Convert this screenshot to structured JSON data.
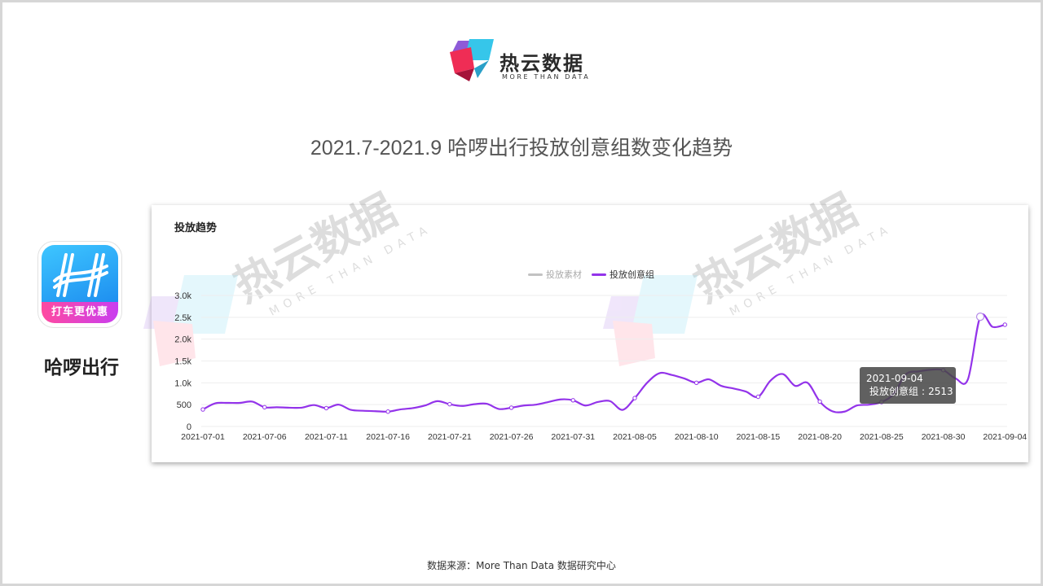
{
  "brand": {
    "name": "热云数据",
    "tagline": "MORE THAN DATA"
  },
  "page_title": "2021.7-2021.9 哈啰出行投放创意组数变化趋势",
  "app": {
    "name": "哈啰出行",
    "slogan": "打车更优惠"
  },
  "chart_title": "投放趋势",
  "watermark": {
    "name": "热云数据",
    "tagline": "MORE THAN DATA"
  },
  "legend": [
    {
      "name": "投放素材",
      "color": "#c2c2c2",
      "active": false
    },
    {
      "name": "投放创意组",
      "color": "#9333ea",
      "active": true
    }
  ],
  "tooltip": {
    "date": "2021-09-04",
    "series": "投放创意组",
    "value_text": "2513"
  },
  "footer": "数据来源：More Than Data 数据研究中心",
  "colors": {
    "line": "#9333ea",
    "grid": "#eeeeee",
    "tick_text": "#333333"
  },
  "chart_data": {
    "type": "line",
    "title": "投放趋势",
    "xlabel": "",
    "ylabel": "",
    "ylim": [
      0,
      3000
    ],
    "y_ticks": [
      0,
      500,
      1000,
      1500,
      2000,
      2500,
      3000
    ],
    "y_tick_labels": [
      "0",
      "500",
      "1.0k",
      "1.5k",
      "2.0k",
      "2.5k",
      "3.0k"
    ],
    "x_tick_labels": [
      "2021-07-01",
      "2021-07-06",
      "2021-07-11",
      "2021-07-16",
      "2021-07-21",
      "2021-07-26",
      "2021-07-31",
      "2021-08-05",
      "2021-08-10",
      "2021-08-15",
      "2021-08-20",
      "2021-08-25",
      "2021-08-30",
      "2021-09-04"
    ],
    "grid": true,
    "legend_position": "top-center",
    "x_start": "2021-07-01",
    "series": [
      {
        "name": "投放创意组",
        "values": [
          390,
          530,
          540,
          540,
          570,
          440,
          440,
          430,
          430,
          490,
          420,
          500,
          380,
          360,
          350,
          340,
          390,
          420,
          480,
          580,
          510,
          470,
          510,
          520,
          400,
          430,
          480,
          500,
          560,
          620,
          600,
          480,
          560,
          580,
          380,
          650,
          1000,
          1220,
          1180,
          1100,
          1000,
          1080,
          930,
          870,
          800,
          680,
          1050,
          1200,
          930,
          1000,
          570,
          350,
          340,
          480,
          500,
          560,
          750,
          1200,
          1260,
          1300,
          1290,
          1100,
          1080,
          2513,
          2280,
          2330
        ]
      }
    ],
    "markers": [
      {
        "series": "投放创意组",
        "date": "2021-09-04",
        "value": 2513
      }
    ]
  }
}
